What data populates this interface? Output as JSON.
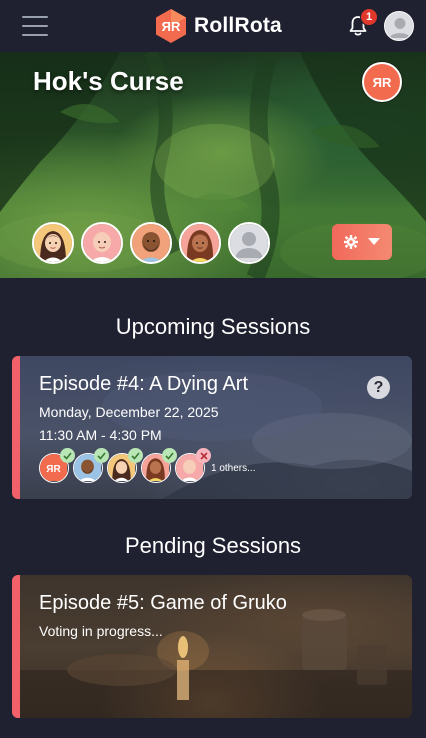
{
  "brand": {
    "name": "RollRota",
    "logo_text": "ЯR"
  },
  "notifications": {
    "count": "1"
  },
  "campaign": {
    "title": "Hok's Curse",
    "badge_text": "ЯR"
  },
  "upcoming": {
    "heading": "Upcoming Sessions",
    "session": {
      "title": "Episode #4: A Dying Art",
      "date": "Monday, December 22, 2025",
      "time": "11:30 AM - 4:30 PM",
      "help_label": "?",
      "others_label": "1 others...",
      "attendee_logo_text": "ЯR"
    }
  },
  "pending": {
    "heading": "Pending Sessions",
    "session": {
      "title": "Episode #5: Game of Gruko",
      "status": "Voting in progress..."
    }
  },
  "colors": {
    "brand_accent": "#f36b4f",
    "card_accent": "#f2616a",
    "notification_badge": "#e0392b",
    "background": "#1f2130"
  }
}
